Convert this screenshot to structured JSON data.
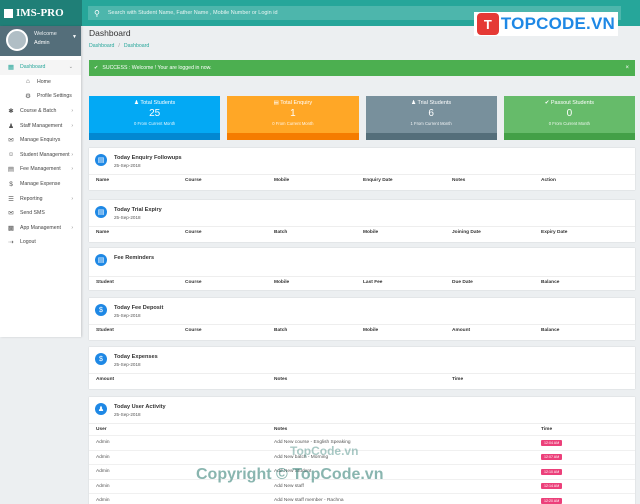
{
  "app": {
    "logo": "IMS-PRO"
  },
  "search": {
    "placeholder": "Search with Student Name, Father Name , Mobile Number or Login id"
  },
  "brand": {
    "mark": "T",
    "text": "TOPCODE.VN"
  },
  "profile": {
    "name": "Welcome",
    "role": "Admin"
  },
  "sidebar": {
    "items": [
      {
        "label": "Dashboard",
        "icon": "dashboard-icon"
      },
      {
        "label": "Home",
        "icon": "home-icon"
      },
      {
        "label": "Profile Settings",
        "icon": "gear-icon"
      },
      {
        "label": "Course & Batch",
        "icon": "batch-icon"
      },
      {
        "label": "Staff Management",
        "icon": "staff-icon"
      },
      {
        "label": "Manage Enquirys",
        "icon": "enquiry-icon"
      },
      {
        "label": "Student Management",
        "icon": "students-icon"
      },
      {
        "label": "Fee Management",
        "icon": "fee-icon"
      },
      {
        "label": "Manage Expense",
        "icon": "expense-icon"
      },
      {
        "label": "Reporting",
        "icon": "report-icon"
      },
      {
        "label": "Send SMS",
        "icon": "sms-icon"
      },
      {
        "label": "App Management",
        "icon": "app-icon"
      },
      {
        "label": "Logout",
        "icon": "logout-icon"
      }
    ]
  },
  "page": {
    "title": "Dashboard",
    "crumb1": "Dashboard",
    "crumb2": "Dashboard"
  },
  "alert": {
    "text": "SUCCESS : Welcome ! Your are logged in now.",
    "close": "×"
  },
  "stats": [
    {
      "label": "Total Students",
      "value": "25",
      "sub": "0 From Current Month",
      "color": "#03a9f4",
      "bottom": "#0288d1"
    },
    {
      "label": "Total Enquiry",
      "value": "1",
      "sub": "0 From Current Month",
      "color": "#ffa726",
      "bottom": "#f57c00"
    },
    {
      "label": "Trial Students",
      "value": "6",
      "sub": "1 From Current Month",
      "color": "#78909c",
      "bottom": "#546e7a"
    },
    {
      "label": "Passout Students",
      "value": "0",
      "sub": "0 From Current Month",
      "color": "#66bb6a",
      "bottom": "#43a047"
    }
  ],
  "panels": {
    "enquiry": {
      "title": "Today Enquiry Followups",
      "date": "25-Sep-2018",
      "cols": [
        "Name",
        "Course",
        "Mobile",
        "Enquiry Date",
        "Notes",
        "Action"
      ]
    },
    "trial": {
      "title": "Today Trial Expiry",
      "date": "25-Sep-2018",
      "cols": [
        "Name",
        "Course",
        "Batch",
        "Mobile",
        "Joining Date",
        "Expiry Date"
      ]
    },
    "fee": {
      "title": "Fee Reminders",
      "cols": [
        "Student",
        "Course",
        "Mobile",
        "Last Fee",
        "Due Date",
        "Balance"
      ]
    },
    "deposit": {
      "title": "Today Fee Deposit",
      "date": "25-Sep-2018",
      "cols": [
        "Student",
        "Course",
        "Batch",
        "Mobile",
        "Amount",
        "Balance"
      ]
    },
    "expenses": {
      "title": "Today Expenses",
      "date": "25-Sep-2018",
      "cols": [
        "Amount",
        "Notes",
        "Time"
      ]
    },
    "activity": {
      "title": "Today User Activity",
      "date": "25-Sep-2018",
      "cols": [
        "User",
        "Notes",
        "Time"
      ],
      "rows": [
        {
          "user": "Admin",
          "notes": "Add New course - English Speaking",
          "time": "12:04 AM"
        },
        {
          "user": "Admin",
          "notes": "Add New batch - Morning",
          "time": "12:07 AM"
        },
        {
          "user": "Admin",
          "notes": "Add New Student",
          "time": "12:10 AM"
        },
        {
          "user": "Admin",
          "notes": "Add New staff",
          "time": "12:14 AM"
        },
        {
          "user": "Admin",
          "notes": "Add New staff member - Rachna",
          "time": "12:20 AM"
        }
      ]
    }
  },
  "watermark": "Copyright © TopCode.vn",
  "watermark2": "TopCode.vn"
}
